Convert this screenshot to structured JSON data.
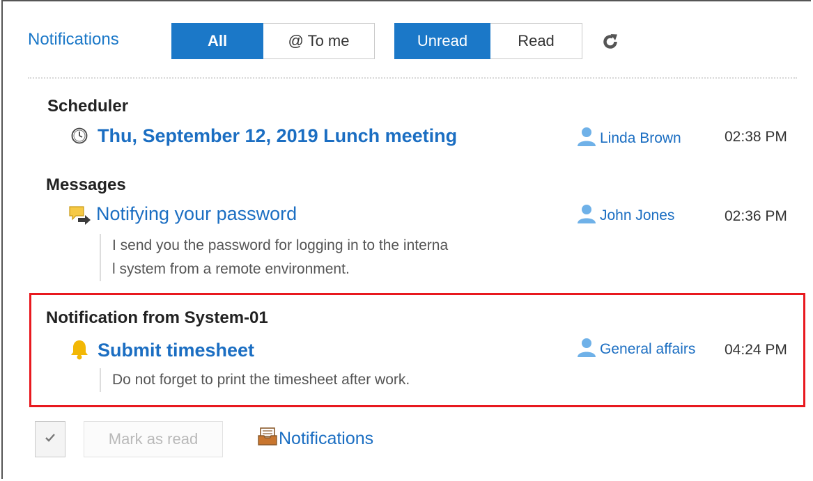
{
  "header": {
    "title": "Notifications",
    "filter_all": "All",
    "filter_to_me": "@ To me",
    "filter_unread": "Unread",
    "filter_read": "Read"
  },
  "groups": [
    {
      "title": "Scheduler",
      "items": [
        {
          "icon": "clock-icon",
          "subject": "Thu, September 12, 2019 Lunch meeting",
          "sender": "Linda Brown",
          "time": "02:38 PM"
        }
      ]
    },
    {
      "title": "Messages",
      "items": [
        {
          "icon": "message-icon",
          "subject": "Notifying your password",
          "sender": "John Jones",
          "time": "02:36 PM",
          "snippet_lines": [
            "I send you the password for logging in to the interna",
            "l system from a remote environment."
          ]
        }
      ]
    },
    {
      "title": "Notification from System-01",
      "items": [
        {
          "icon": "bell-icon",
          "subject": "Submit timesheet",
          "sender": "General affairs",
          "time": "04:24 PM",
          "snippet_lines": [
            "Do not forget to print the timesheet after work."
          ]
        }
      ]
    }
  ],
  "footer": {
    "mark_as_read": "Mark as read",
    "notifications_link": "Notifications"
  },
  "colors": {
    "accent": "#1b78c8",
    "link": "#1b6ec2",
    "highlight_border": "#e8191f"
  }
}
